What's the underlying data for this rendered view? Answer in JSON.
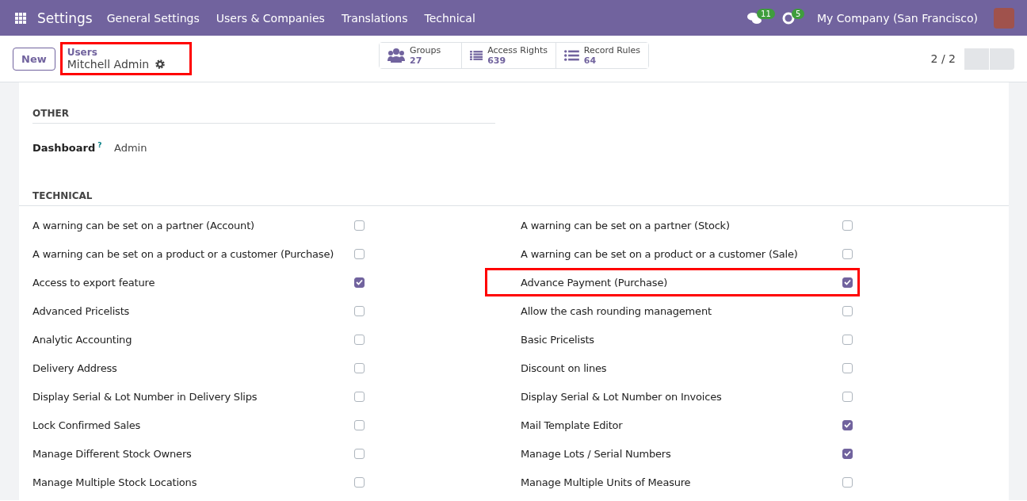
{
  "navbar": {
    "app": "Settings",
    "menus": [
      "General Settings",
      "Users & Companies",
      "Translations",
      "Technical"
    ],
    "messages_count": "11",
    "activities_count": "5",
    "company": "My Company (San Francisco)"
  },
  "control_panel": {
    "new_button": "New",
    "breadcrumb": {
      "parent": "Users",
      "current": "Mitchell Admin",
      "highlighted": true
    },
    "smart_buttons": [
      {
        "kind": "users",
        "label": "Groups",
        "count": "27"
      },
      {
        "kind": "list",
        "label": "Access Rights",
        "count": "639"
      },
      {
        "kind": "bullets",
        "label": "Record Rules",
        "count": "64"
      }
    ],
    "pager": "2 / 2"
  },
  "other": {
    "title": "OTHER",
    "field": {
      "label": "Dashboard",
      "help": "?",
      "value": "Admin"
    }
  },
  "technical": {
    "title": "TECHNICAL",
    "rows": [
      [
        {
          "label": "A warning can be set on a partner (Account)",
          "checked": false,
          "highlighted": false
        },
        {
          "label": "A warning can be set on a partner (Stock)",
          "checked": false,
          "highlighted": false
        }
      ],
      [
        {
          "label": "A warning can be set on a product or a customer (Purchase)",
          "checked": false,
          "highlighted": false
        },
        {
          "label": "A warning can be set on a product or a customer (Sale)",
          "checked": false,
          "highlighted": false
        }
      ],
      [
        {
          "label": "Access to export feature",
          "checked": true,
          "highlighted": false
        },
        {
          "label": "Advance Payment (Purchase)",
          "checked": true,
          "highlighted": true
        }
      ],
      [
        {
          "label": "Advanced Pricelists",
          "checked": false,
          "highlighted": false
        },
        {
          "label": "Allow the cash rounding management",
          "checked": false,
          "highlighted": false
        }
      ],
      [
        {
          "label": "Analytic Accounting",
          "checked": false,
          "highlighted": false
        },
        {
          "label": "Basic Pricelists",
          "checked": false,
          "highlighted": false
        }
      ],
      [
        {
          "label": "Delivery Address",
          "checked": false,
          "highlighted": false
        },
        {
          "label": "Discount on lines",
          "checked": false,
          "highlighted": false
        }
      ],
      [
        {
          "label": "Display Serial & Lot Number in Delivery Slips",
          "checked": false,
          "highlighted": false
        },
        {
          "label": "Display Serial & Lot Number on Invoices",
          "checked": false,
          "highlighted": false
        }
      ],
      [
        {
          "label": "Lock Confirmed Sales",
          "checked": false,
          "highlighted": false
        },
        {
          "label": "Mail Template Editor",
          "checked": true,
          "highlighted": false
        }
      ],
      [
        {
          "label": "Manage Different Stock Owners",
          "checked": false,
          "highlighted": false
        },
        {
          "label": "Manage Lots / Serial Numbers",
          "checked": true,
          "highlighted": false
        }
      ],
      [
        {
          "label": "Manage Multiple Stock Locations",
          "checked": false,
          "highlighted": false
        },
        {
          "label": "Manage Multiple Units of Measure",
          "checked": false,
          "highlighted": false
        }
      ]
    ]
  }
}
